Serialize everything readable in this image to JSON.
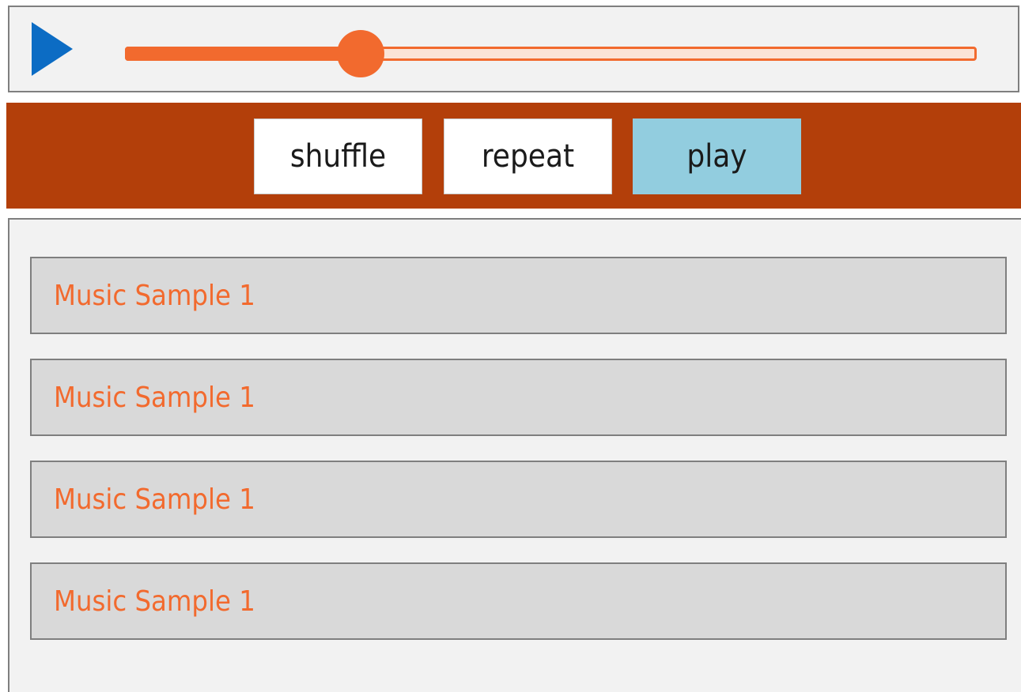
{
  "player": {
    "play_icon": "play-icon",
    "progress": 0.277,
    "accent_color": "#f26a2e",
    "icon_color": "#0c6cc4"
  },
  "controls": {
    "background": "#b33f0a",
    "buttons": [
      {
        "label": "shuffle",
        "active": false
      },
      {
        "label": "repeat",
        "active": false
      },
      {
        "label": "play",
        "active": true
      }
    ]
  },
  "playlist": {
    "items": [
      {
        "label": "Music Sample 1"
      },
      {
        "label": "Music Sample 1"
      },
      {
        "label": "Music Sample 1"
      },
      {
        "label": "Music Sample 1"
      }
    ]
  }
}
